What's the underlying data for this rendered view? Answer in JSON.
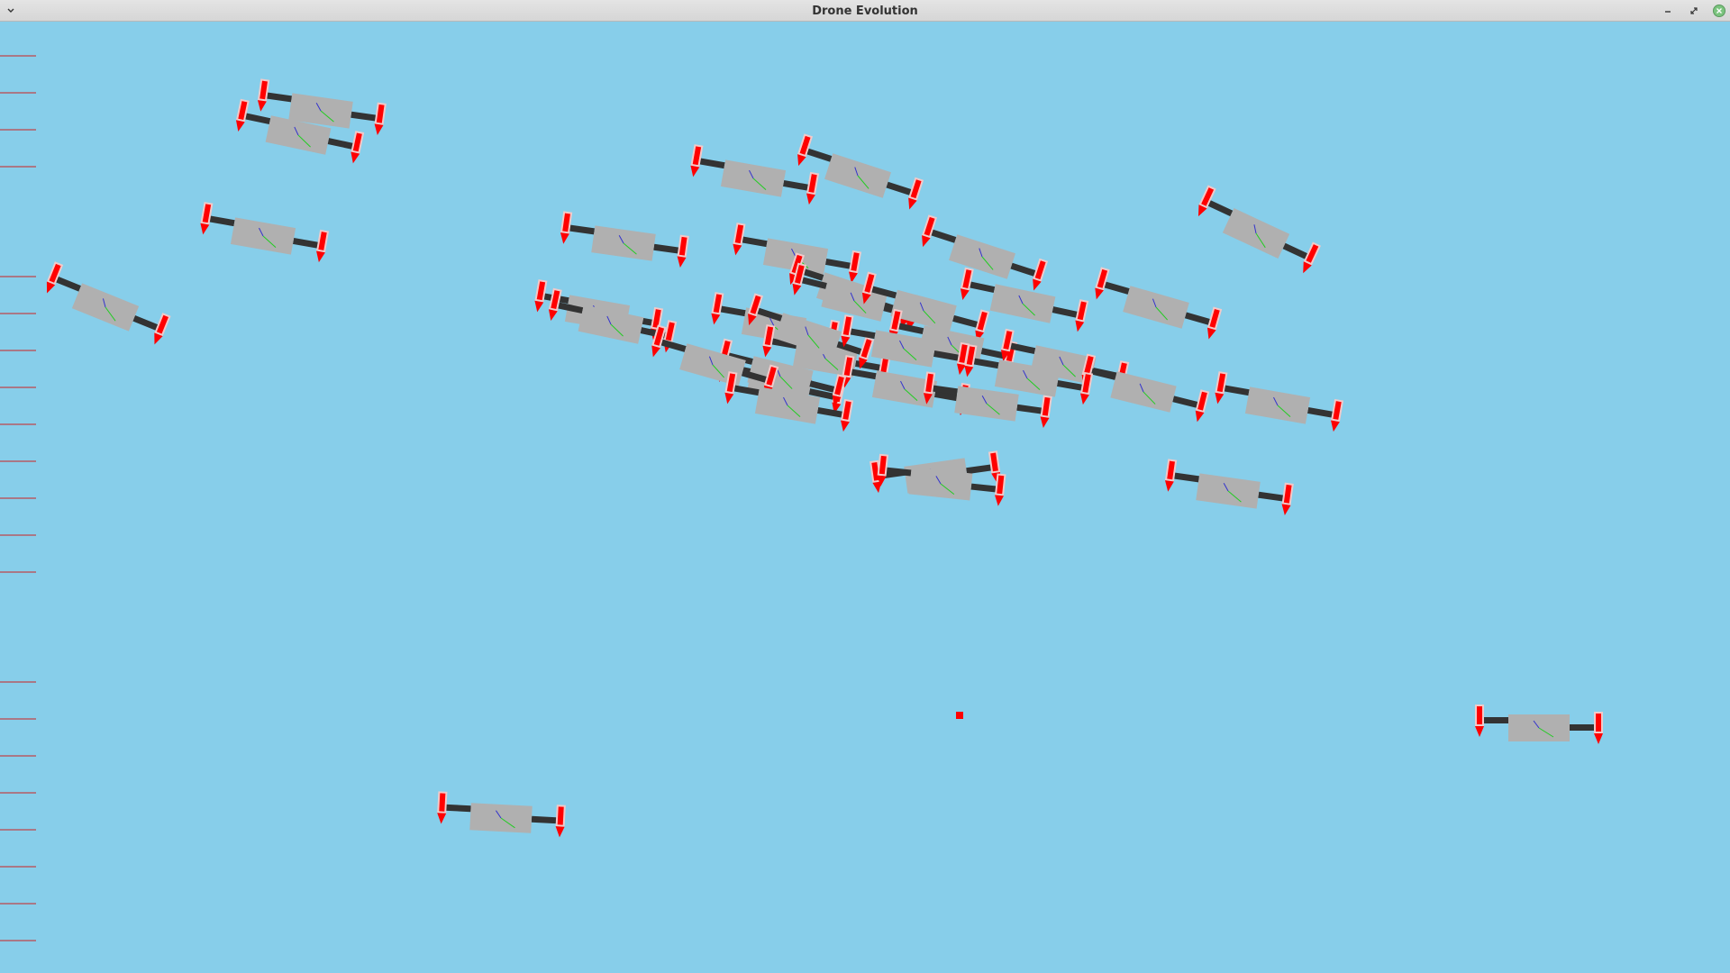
{
  "window": {
    "title": "Drone Evolution",
    "controls": [
      "menu-chevron-icon",
      "minimize-icon",
      "restore-icon",
      "close-icon"
    ]
  },
  "scene": {
    "background_color": "#87ceea",
    "drone_colors": {
      "body": "#b0b0b0",
      "arm": "#333333",
      "thruster": "#ff0000",
      "thruster_housing": "#f2c9c9",
      "axis_green": "#22cc22",
      "axis_blue": "#3333cc"
    },
    "target_marker_color": "#ff0000",
    "left_ruler_color": "#cc2222",
    "drone_count": 37
  }
}
